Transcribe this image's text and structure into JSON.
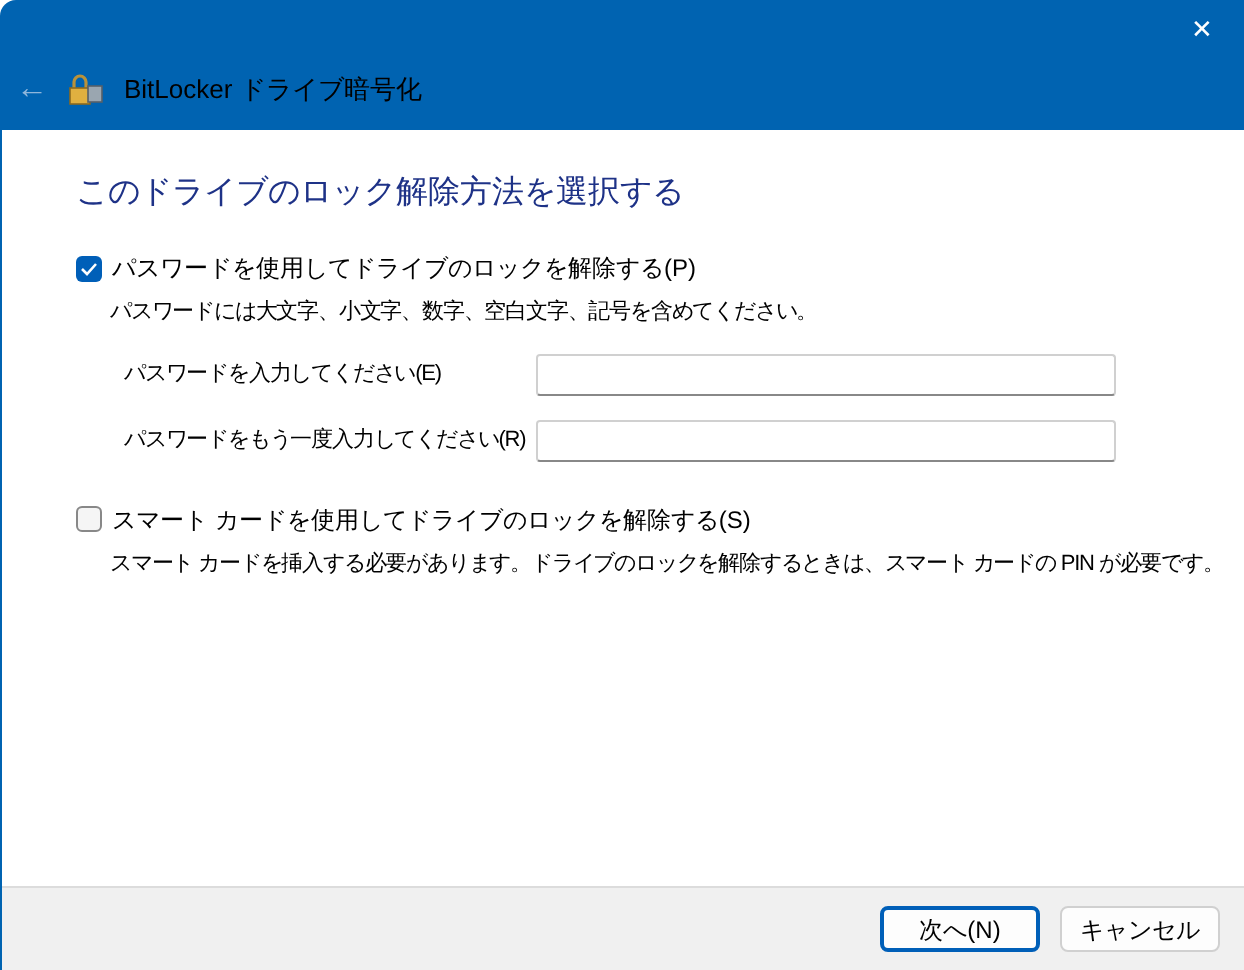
{
  "window": {
    "title": "BitLocker ドライブ暗号化",
    "close_glyph": "✕",
    "back_glyph": "←"
  },
  "heading": "このドライブのロック解除方法を選択する",
  "options": [
    {
      "label": "パスワードを使用してドライブのロックを解除する(P)",
      "checked": true,
      "description": "パスワードには大文字、小文字、数字、空白文字、記号を含めてください。",
      "fields": [
        {
          "label": "パスワードを入力してください(E)"
        },
        {
          "label": "パスワードをもう一度入力してください(R)"
        }
      ]
    },
    {
      "label": "スマート カードを使用してドライブのロックを解除する(S)",
      "checked": false,
      "description": "スマート カードを挿入する必要があります。ドライブのロックを解除するときは、スマート カードの PIN が必要です。"
    }
  ],
  "buttons": [
    {
      "label": "次へ(N)",
      "default": true
    },
    {
      "label": "キャンセル",
      "default": false
    }
  ]
}
